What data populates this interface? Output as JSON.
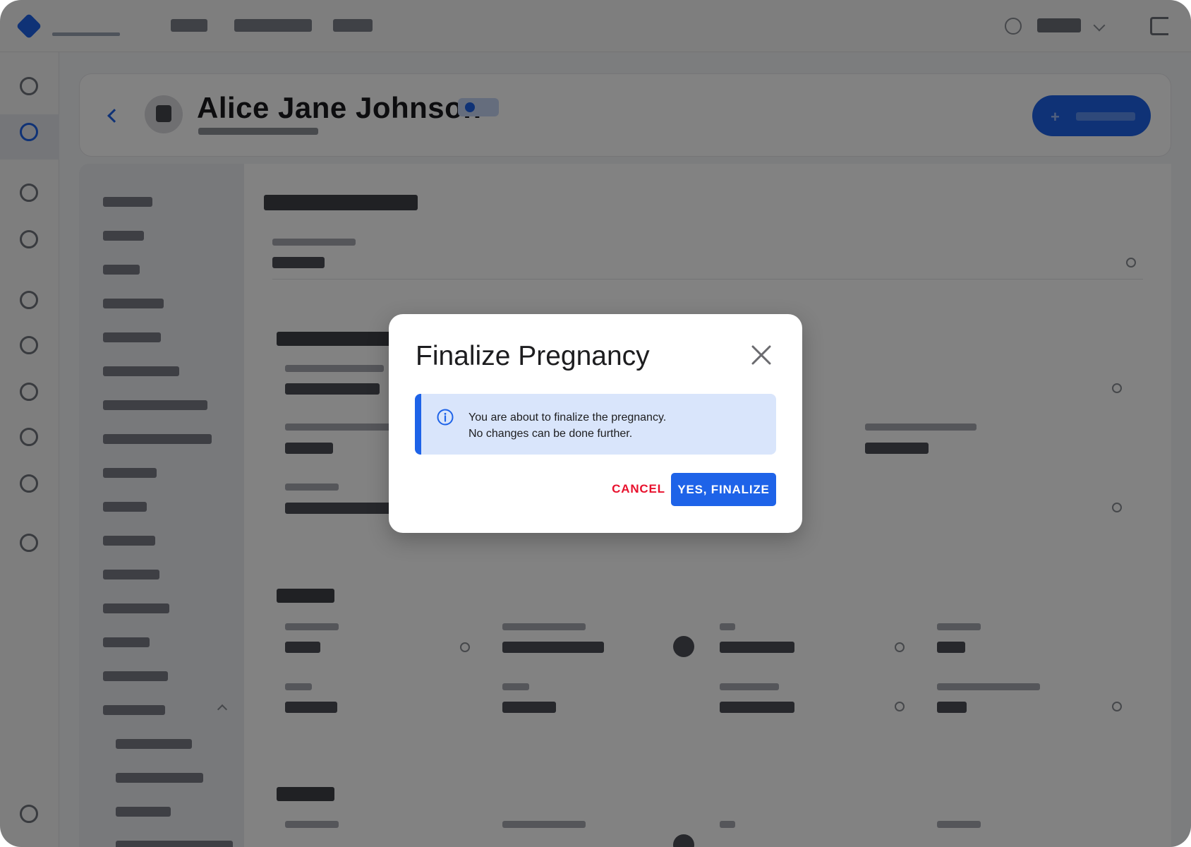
{
  "background": {
    "patient_name": "Alice Jane Johnson"
  },
  "dialog": {
    "title": "Finalize Pregnancy",
    "close_icon": "close-icon",
    "info_icon": "info-circle-icon",
    "message_line1": "You are about to finalize the pregnancy.",
    "message_line2": "No changes can be done further.",
    "cancel_label": "CANCEL",
    "confirm_label": "YES, FINALIZE"
  },
  "colors": {
    "accent": "#1e63e8",
    "danger": "#e8112d",
    "info_background": "#d9e5fb",
    "overlay": "rgba(0,0,0,0.49)"
  }
}
